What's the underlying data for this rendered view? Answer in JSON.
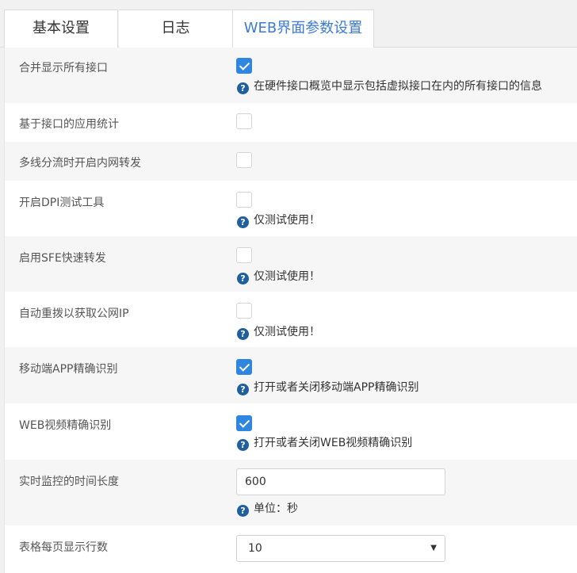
{
  "tabs": [
    "基本设置",
    "日志",
    "WEB界面参数设置"
  ],
  "rows": [
    {
      "label": "合并显示所有接口",
      "checked": true,
      "help": "在硬件接口概览中显示包括虚拟接口在内的所有接口的信息"
    },
    {
      "label": "基于接口的应用统计",
      "checked": false
    },
    {
      "label": "多线分流时开启内网转发",
      "checked": false
    },
    {
      "label": "开启DPI测试工具",
      "checked": false,
      "help": "仅测试使用！"
    },
    {
      "label": "启用SFE快速转发",
      "checked": false,
      "help": "仅测试使用！"
    },
    {
      "label": "自动重拨以获取公网IP",
      "checked": false,
      "help": "仅测试使用！"
    },
    {
      "label": "移动端APP精确识别",
      "checked": true,
      "help": "打开或者关闭移动端APP精确识别"
    },
    {
      "label": "WEB视频精确识别",
      "checked": true,
      "help": "打开或者关闭WEB视频精确识别"
    }
  ],
  "monitor": {
    "label": "实时监控的时间长度",
    "value": "600",
    "help": "单位：秒"
  },
  "rows_per_page": {
    "label": "表格每页显示行数",
    "value": "10"
  },
  "icons": {
    "help": "question-circle-icon",
    "caret": "caret-down-icon"
  },
  "colors": {
    "active_tab": "#3c7bd4",
    "checkbox_on": "#2f86e0",
    "help_icon": "#1f5f9e"
  }
}
